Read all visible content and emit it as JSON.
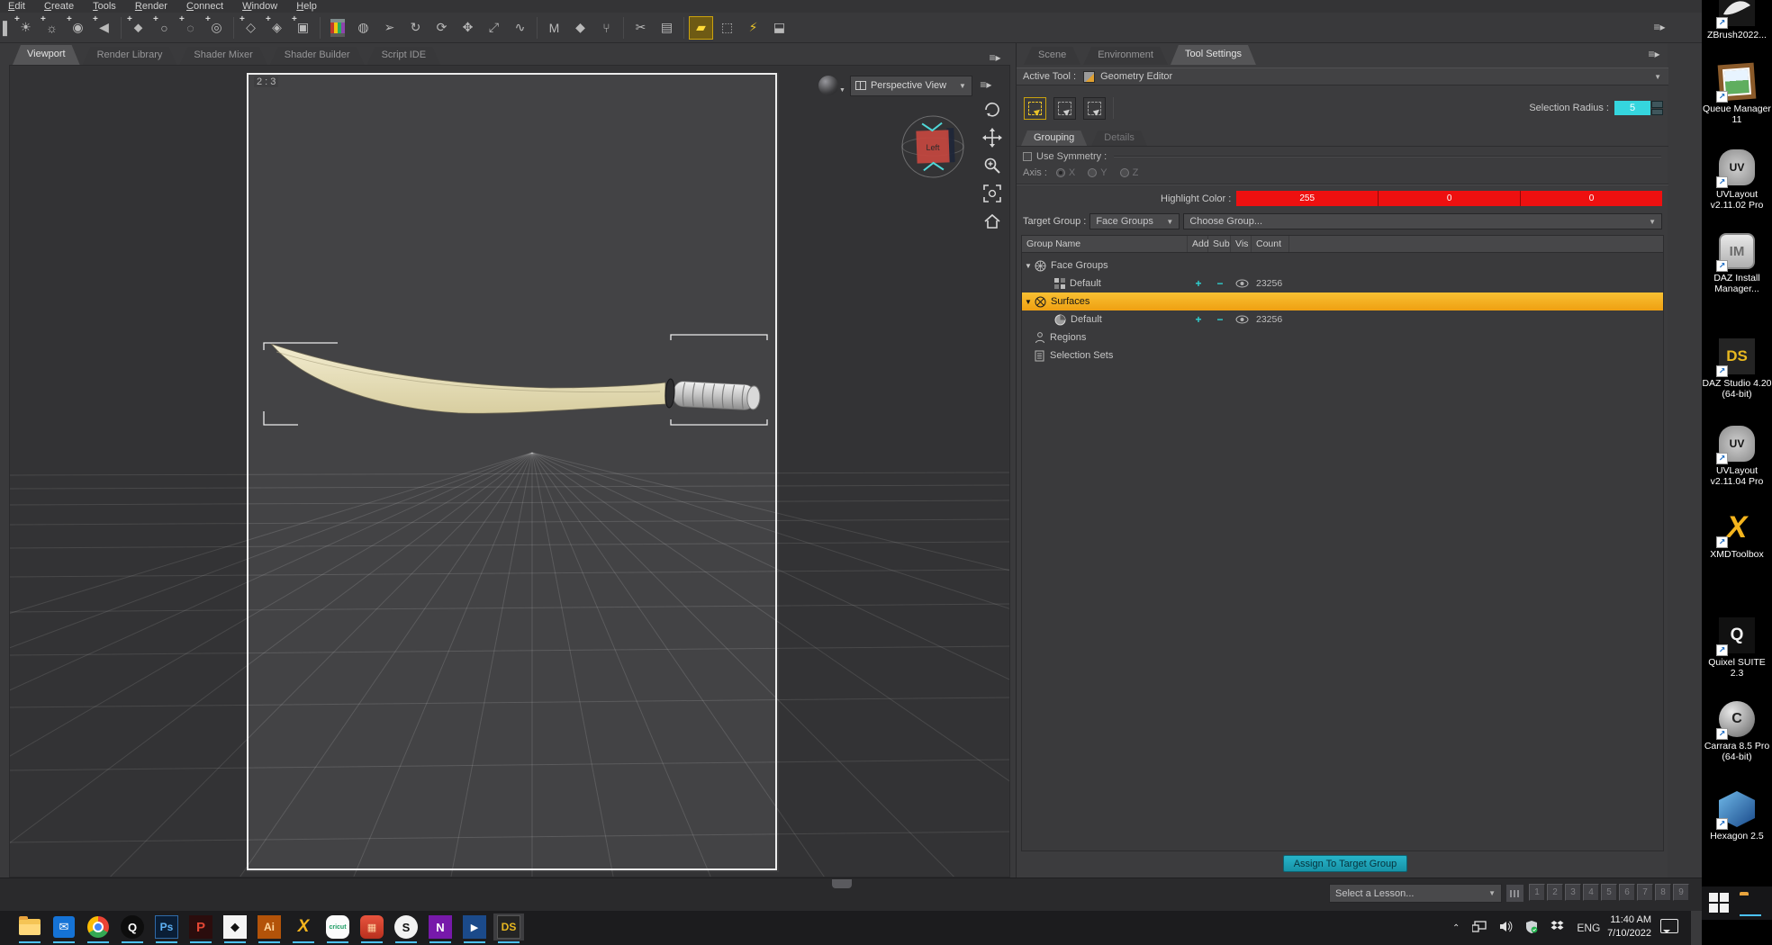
{
  "menu": {
    "items": [
      "Edit",
      "Create",
      "Tools",
      "Render",
      "Connect",
      "Window",
      "Help"
    ]
  },
  "toolbar": {
    "icons": [
      "node-sliver",
      "new-distant-light",
      "new-point-light",
      "new-camera",
      "new-spotlight",
      "new-primitive",
      "new-null",
      "new-dform",
      "new-bone",
      "new-group",
      "new-instance",
      "new-cube",
      "render-grid",
      "globe",
      "node-selection",
      "rotate",
      "orbit",
      "translate",
      "scale",
      "curve",
      "letter-m",
      "diamond",
      "figures",
      "knife",
      "layers",
      "geometry-editor-active",
      "transfer-box",
      "flash",
      "camera"
    ]
  },
  "pane_tabs": {
    "items": [
      "Viewport",
      "Render Library",
      "Shader Mixer",
      "Shader Builder",
      "Script IDE"
    ],
    "active": "Viewport"
  },
  "viewport": {
    "aspect_label": "2 : 3",
    "view_selector": "Perspective View",
    "cube_face": "Left",
    "controls": [
      "orbit",
      "pan",
      "dolly",
      "frame",
      "home"
    ]
  },
  "dock": {
    "tabs": [
      "Scene",
      "Environment",
      "Tool Settings"
    ],
    "active_tab": "Tool Settings",
    "active_tool_label": "Active Tool :",
    "active_tool_value": "Geometry Editor",
    "selection_modes": [
      "marquee-select",
      "lasso-select",
      "drag-select"
    ],
    "selection_radius_label": "Selection Radius :",
    "selection_radius_value": "5",
    "sub_tabs": [
      "Grouping",
      "Details"
    ],
    "active_sub_tab": "Grouping",
    "use_symmetry_label": "Use Symmetry :",
    "axis_label": "Axis :",
    "axis_options": [
      "X",
      "Y",
      "Z"
    ],
    "highlight_color_label": "Highlight Color :",
    "highlight_rgb": [
      "255",
      "0",
      "0"
    ],
    "highlight_color": "#ee1010",
    "target_group_label": "Target Group :",
    "target_group_value": "Face Groups",
    "choose_group_label": "Choose Group...",
    "tree": {
      "columns": [
        "Group Name",
        "Add",
        "Sub",
        "Vis",
        "Count"
      ],
      "highlight_row_color": "#f2a918",
      "rows": [
        {
          "label": "Face Groups"
        },
        {
          "label": "Default",
          "count": "23256"
        },
        {
          "label": "Surfaces",
          "highlighted": true
        },
        {
          "label": "Default",
          "count": "23256"
        },
        {
          "label": "Regions"
        },
        {
          "label": "Selection Sets"
        }
      ]
    },
    "assign_button_label": "Assign To Target Group"
  },
  "lessons": {
    "dropdown_label": "Select a Lesson...",
    "numbers": [
      "1",
      "2",
      "3",
      "4",
      "5",
      "6",
      "7",
      "8",
      "9"
    ]
  },
  "taskbar": {
    "icons": [
      {
        "name": "file-explorer"
      },
      {
        "name": "mail"
      },
      {
        "name": "chrome"
      },
      {
        "name": "black-q-app",
        "glyph": "Q"
      },
      {
        "name": "photoshop",
        "glyph": "Ps"
      },
      {
        "name": "red-p-app",
        "glyph": "P"
      },
      {
        "name": "unity",
        "glyph": "◆"
      },
      {
        "name": "illustrator",
        "glyph": "Ai"
      },
      {
        "name": "xmd-toolbox",
        "glyph": "X"
      },
      {
        "name": "cricut",
        "glyph": "cricut"
      },
      {
        "name": "red-app"
      },
      {
        "name": "s-app",
        "glyph": "S"
      },
      {
        "name": "onenote",
        "glyph": "N"
      },
      {
        "name": "movies-tv",
        "glyph": "▶"
      },
      {
        "name": "daz-studio",
        "glyph": "DS"
      }
    ],
    "tray": {
      "language": "ENG",
      "time": "11:40 AM",
      "date": "7/10/2022"
    }
  },
  "desktop": {
    "icons": [
      {
        "label": "ZBrush2022..."
      },
      {
        "label": "Queue Manager 11"
      },
      {
        "label": "UVLayout v2.11.02 Pro"
      },
      {
        "label": "DAZ Install Manager..."
      },
      {
        "label": "DAZ Studio 4.20 (64-bit)"
      },
      {
        "label": "UVLayout v2.11.04 Pro"
      },
      {
        "label": "XMDToolbox"
      },
      {
        "label": "Quixel SUITE 2.3"
      },
      {
        "label": "Carrara 8.5 Pro (64-bit)"
      },
      {
        "label": "Hexagon 2.5"
      }
    ]
  }
}
